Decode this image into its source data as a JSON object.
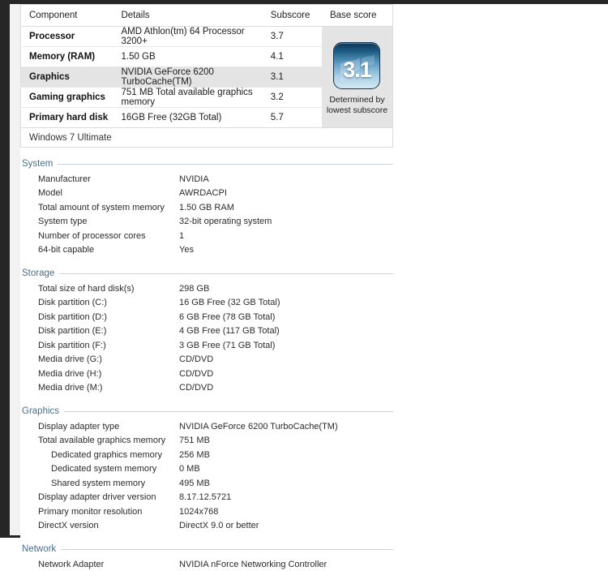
{
  "rating_table": {
    "columns": [
      "Component",
      "Details",
      "Subscore",
      "Base score"
    ],
    "rows": [
      {
        "component": "Processor",
        "details": "AMD Athlon(tm) 64 Processor 3200+",
        "subscore": "3.7",
        "highlight": false
      },
      {
        "component": "Memory (RAM)",
        "details": "1.50 GB",
        "subscore": "4.1",
        "highlight": false
      },
      {
        "component": "Graphics",
        "details": "NVIDIA GeForce 6200 TurboCache(TM)",
        "subscore": "3.1",
        "highlight": true
      },
      {
        "component": "Gaming graphics",
        "details": "751 MB Total available graphics memory",
        "subscore": "3.2",
        "highlight": false
      },
      {
        "component": "Primary hard disk",
        "details": "16GB Free (32GB Total)",
        "subscore": "5.7",
        "highlight": false
      }
    ],
    "base_score": "3.1",
    "base_caption": "Determined by lowest subscore",
    "os_name": "Windows 7 Ultimate"
  },
  "sections": [
    {
      "title": "System",
      "rows": [
        {
          "label": "Manufacturer",
          "value": "NVIDIA",
          "indent": false
        },
        {
          "label": "Model",
          "value": "AWRDACPI",
          "indent": false
        },
        {
          "label": "Total amount of system memory",
          "value": "1.50 GB RAM",
          "indent": false
        },
        {
          "label": "System type",
          "value": "32-bit operating system",
          "indent": false
        },
        {
          "label": "Number of processor cores",
          "value": "1",
          "indent": false
        },
        {
          "label": "64-bit capable",
          "value": "Yes",
          "indent": false
        }
      ]
    },
    {
      "title": "Storage",
      "rows": [
        {
          "label": "Total size of hard disk(s)",
          "value": "298 GB",
          "indent": false
        },
        {
          "label": "Disk partition (C:)",
          "value": "16 GB Free (32 GB Total)",
          "indent": false
        },
        {
          "label": "Disk partition (D:)",
          "value": "6 GB Free (78 GB Total)",
          "indent": false
        },
        {
          "label": "Disk partition (E:)",
          "value": "4 GB Free (117 GB Total)",
          "indent": false
        },
        {
          "label": "Disk partition (F:)",
          "value": "3 GB Free (71 GB Total)",
          "indent": false
        },
        {
          "label": "Media drive (G:)",
          "value": "CD/DVD",
          "indent": false
        },
        {
          "label": "Media drive (H:)",
          "value": "CD/DVD",
          "indent": false
        },
        {
          "label": "Media drive (M:)",
          "value": "CD/DVD",
          "indent": false
        }
      ]
    },
    {
      "title": "Graphics",
      "rows": [
        {
          "label": "Display adapter type",
          "value": "NVIDIA GeForce 6200 TurboCache(TM)",
          "indent": false
        },
        {
          "label": "Total available graphics memory",
          "value": "751 MB",
          "indent": false
        },
        {
          "label": "Dedicated graphics memory",
          "value": "256 MB",
          "indent": true
        },
        {
          "label": "Dedicated system memory",
          "value": "0 MB",
          "indent": true
        },
        {
          "label": "Shared system memory",
          "value": "495 MB",
          "indent": true
        },
        {
          "label": "Display adapter driver version",
          "value": "8.17.12.5721",
          "indent": false
        },
        {
          "label": "Primary monitor resolution",
          "value": "1024x768",
          "indent": false
        },
        {
          "label": "DirectX version",
          "value": "DirectX 9.0 or better",
          "indent": false
        }
      ]
    },
    {
      "title": "Network",
      "rows": [
        {
          "label": "Network Adapter",
          "value": "NVIDIA nForce Networking Controller",
          "indent": false
        }
      ]
    }
  ],
  "colors": {
    "section_heading": "#4a6f8a",
    "badge_dark": "#0e3455",
    "badge_light": "#d5e9f4",
    "row_highlight": "#e4e4e4"
  }
}
